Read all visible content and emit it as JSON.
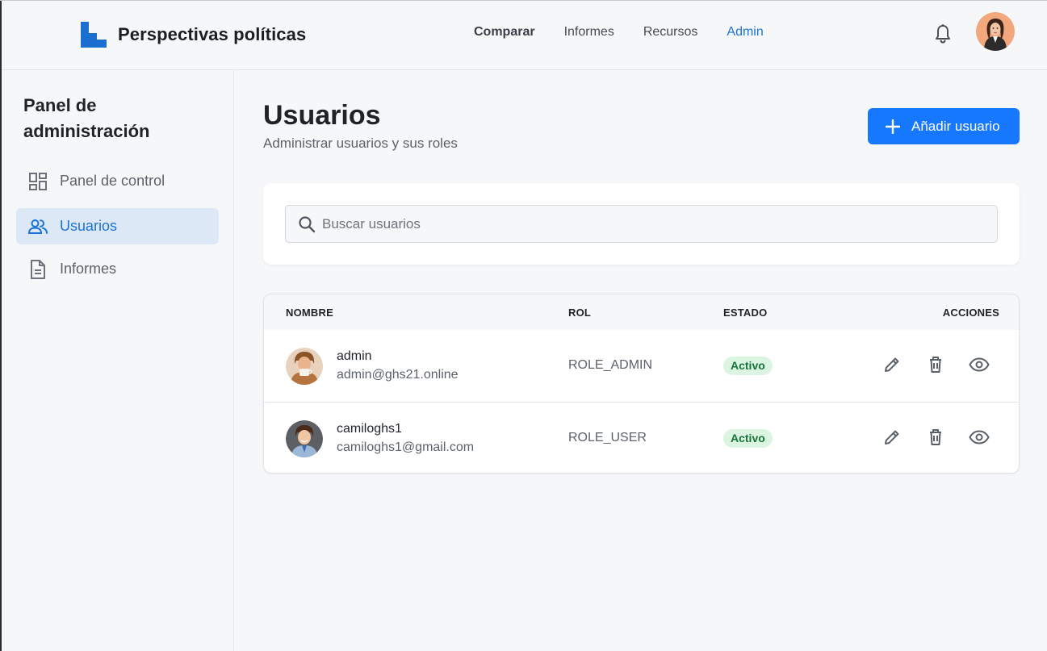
{
  "header": {
    "brand": "Perspectivas políticas",
    "nav": [
      {
        "label": "Comparar"
      },
      {
        "label": "Informes"
      },
      {
        "label": "Recursos"
      },
      {
        "label": "Admin"
      }
    ]
  },
  "sidebar": {
    "title": "Panel de administración",
    "items": [
      {
        "label": "Panel de control",
        "icon": "dashboard-icon"
      },
      {
        "label": "Usuarios",
        "icon": "users-icon",
        "active": true
      },
      {
        "label": "Informes",
        "icon": "document-icon"
      }
    ]
  },
  "main": {
    "title": "Usuarios",
    "subtitle": "Administrar usuarios y sus roles",
    "add_button": "Añadir usuario",
    "search": {
      "placeholder": "Buscar usuarios",
      "value": ""
    },
    "table": {
      "columns": [
        "NOMBRE",
        "ROL",
        "ESTADO",
        "ACCIONES"
      ],
      "rows": [
        {
          "name": "admin",
          "email": "admin@ghs21.online",
          "role": "ROLE_ADMIN",
          "status": "Activo"
        },
        {
          "name": "camiloghs1",
          "email": "camiloghs1@gmail.com",
          "role": "ROLE_USER",
          "status": "Activo"
        }
      ]
    }
  },
  "colors": {
    "accent": "#1677ff",
    "active_nav": "#1a73d9",
    "status_bg": "#dcf5e3",
    "status_text": "#17733a"
  }
}
